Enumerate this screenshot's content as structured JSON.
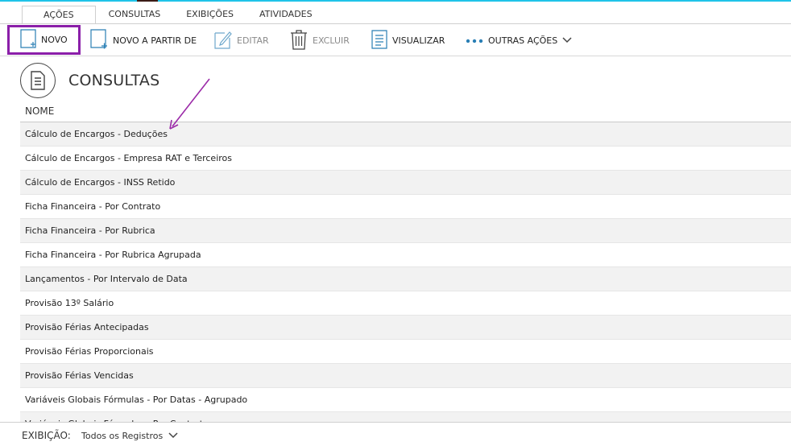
{
  "tabs": [
    {
      "label": "AÇÕES",
      "active": true
    },
    {
      "label": "CONSULTAS",
      "active": false
    },
    {
      "label": "EXIBIÇÕES",
      "active": false
    },
    {
      "label": "ATIVIDADES",
      "active": false
    }
  ],
  "toolbar": {
    "novo": "NOVO",
    "novo_a_partir_de": "NOVO A PARTIR DE",
    "editar": "EDITAR",
    "excluir": "EXCLUIR",
    "visualizar": "VISUALIZAR",
    "outras_acoes": "OUTRAS AÇÕES"
  },
  "page": {
    "title": "CONSULTAS",
    "column_header": "NOME"
  },
  "rows": [
    "Cálculo de Encargos - Deduções",
    "Cálculo de Encargos - Empresa RAT e Terceiros",
    "Cálculo de Encargos - INSS Retido",
    "Ficha Financeira - Por Contrato",
    "Ficha Financeira - Por Rubrica",
    "Ficha Financeira - Por Rubrica Agrupada",
    "Lançamentos - Por Intervalo de Data",
    "Provisão 13º Salário",
    "Provisão Férias Antecipadas",
    "Provisão Férias Proporcionais",
    "Provisão Férias Vencidas",
    "Variáveis Globais Fórmulas - Por Datas - Agrupado",
    "Variáveis Globais Fórmulas - Por Contrato"
  ],
  "footer": {
    "label": "EXIBIÇÃO:",
    "value": "Todos os Registros"
  },
  "colors": {
    "accent_top": "#1fc3e8",
    "highlight_border": "#8b1fa9",
    "icon_blue": "#2a7fb5",
    "annotation_arrow": "#9b2aa8"
  },
  "icons": {
    "novo": "new-document-icon",
    "novo_a_partir_de": "new-from-document-icon",
    "editar": "edit-pencil-icon",
    "excluir": "trash-icon",
    "visualizar": "view-document-icon",
    "outras_acoes": "more-dots-icon",
    "page": "document-icon"
  }
}
